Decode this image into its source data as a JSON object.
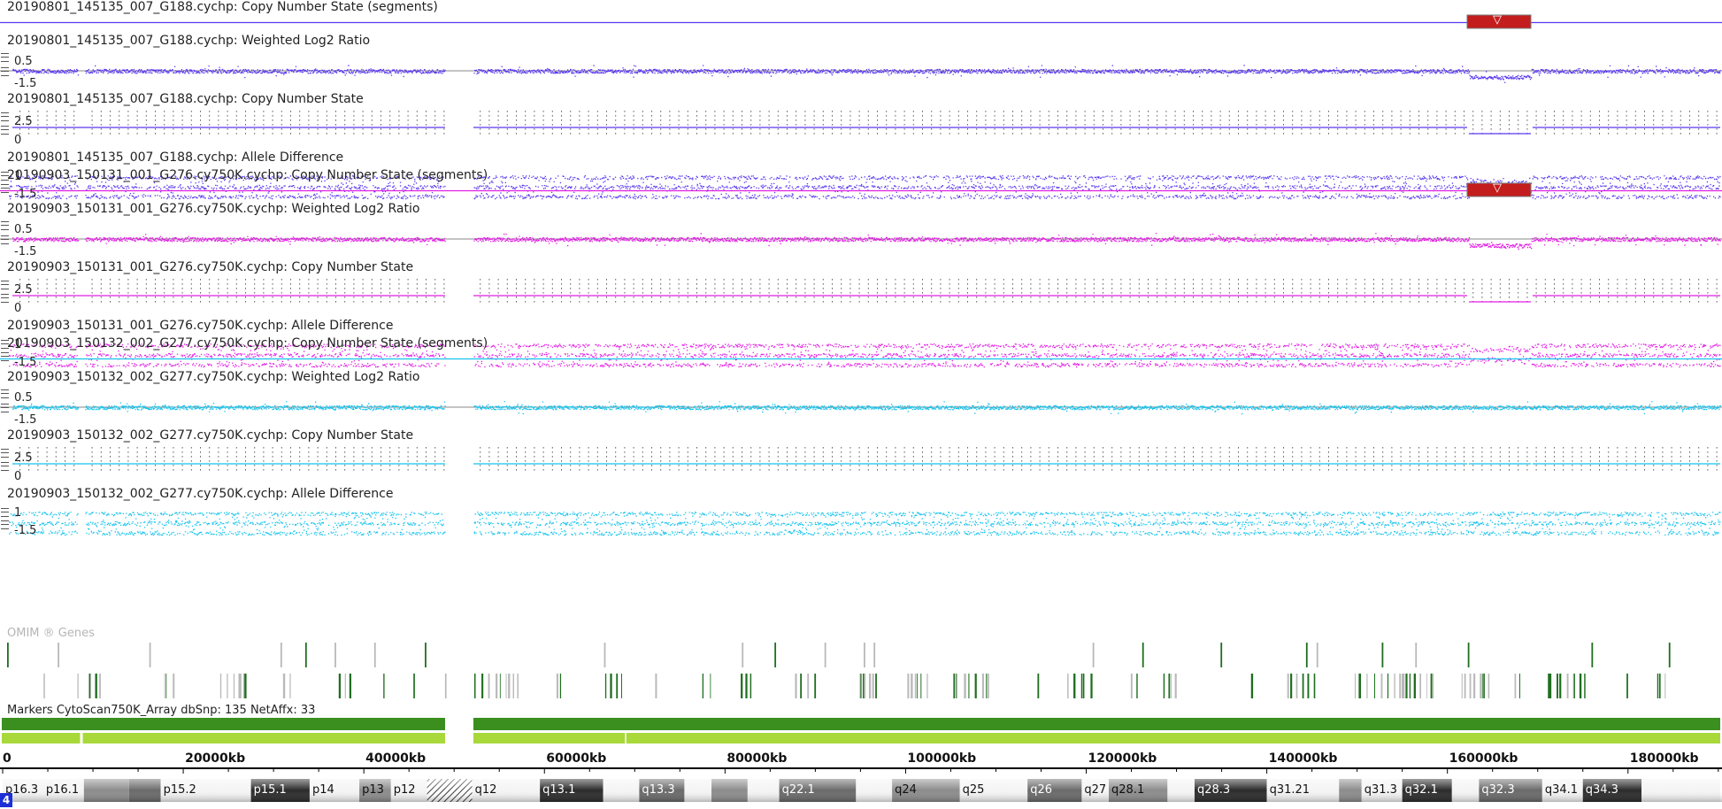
{
  "colors": {
    "sample1": "#5a38f0",
    "sample2": "#e21ee3",
    "sample3": "#15c3ee",
    "loss_marker": "#c41d1d",
    "gene_dark": "#1e6e1e",
    "gene_light": "#b9b9b9",
    "marker_dark": "#3a8f1e",
    "marker_light": "#a8d83a"
  },
  "samples": [
    {
      "segments_label": "20190801_145135_007_G188.cychp: Copy Number State (segments)",
      "log2_label": "20190801_145135_007_G188.cychp: Weighted Log2 Ratio",
      "cn_label": "20190801_145135_007_G188.cychp: Copy Number State",
      "allele_label": "20190801_145135_007_G188.cychp: Allele Difference",
      "has_loss": true,
      "loss_symbol": "▽"
    },
    {
      "segments_label": "20190903_150131_001_G276.cy750K.cychp: Copy Number State (segments)",
      "log2_label": "20190903_150131_001_G276.cy750K.cychp: Weighted Log2 Ratio",
      "cn_label": "20190903_150131_001_G276.cy750K.cychp: Copy Number State",
      "allele_label": "20190903_150131_001_G276.cy750K.cychp: Allele Difference",
      "has_loss": true,
      "loss_symbol": "▽"
    },
    {
      "segments_label": "20190903_150132_002_G277.cy750K.cychp: Copy Number State (segments)",
      "log2_label": "20190903_150132_002_G277.cy750K.cychp: Weighted Log2 Ratio",
      "cn_label": "20190903_150132_002_G277.cy750K.cychp: Copy Number State",
      "allele_label": "20190903_150132_002_G277.cy750K.cychp: Allele Difference",
      "has_loss": false,
      "loss_symbol": ""
    }
  ],
  "axis_labels": {
    "log2_top": "0.5",
    "log2_bottom": "-1.5",
    "cn_top": "2.5",
    "cn_bottom": "0",
    "allele_top": "1",
    "allele_bottom": "-1.5"
  },
  "omim_label": "OMIM ® Genes",
  "markers_label": "Markers CytoScan750K_Array dbSnp: 135 NetAffx: 33",
  "ruler": {
    "ticks": [
      "0",
      "20000kb",
      "40000kb",
      "60000kb",
      "80000kb",
      "100000kb",
      "120000kb",
      "140000kb",
      "160000kb",
      "180000kb"
    ],
    "tick_values_kb": [
      0,
      20000,
      40000,
      60000,
      80000,
      100000,
      120000,
      140000,
      160000,
      180000
    ],
    "max_kb": 190214
  },
  "ideogram": [
    {
      "name": "p16.3",
      "start": 0,
      "end": 4500,
      "stain": "gneg"
    },
    {
      "name": "p16.1",
      "start": 4500,
      "end": 9000,
      "stain": "gneg"
    },
    {
      "name": "",
      "start": 9000,
      "end": 14000,
      "stain": "gpos50"
    },
    {
      "name": "",
      "start": 14000,
      "end": 17500,
      "stain": "gpos75"
    },
    {
      "name": "p15.2",
      "start": 17500,
      "end": 27500,
      "stain": "gneg"
    },
    {
      "name": "p15.1",
      "start": 27500,
      "end": 34000,
      "stain": "gpos100"
    },
    {
      "name": "p14",
      "start": 34000,
      "end": 39500,
      "stain": "gneg"
    },
    {
      "name": "p13",
      "start": 39500,
      "end": 43000,
      "stain": "gpos50"
    },
    {
      "name": "p12",
      "start": 43000,
      "end": 47000,
      "stain": "gneg"
    },
    {
      "name": "",
      "start": 47000,
      "end": 52000,
      "stain": "acen"
    },
    {
      "name": "q12",
      "start": 52000,
      "end": 59500,
      "stain": "gneg"
    },
    {
      "name": "q13.1",
      "start": 59500,
      "end": 66500,
      "stain": "gpos100"
    },
    {
      "name": "",
      "start": 66500,
      "end": 70500,
      "stain": "gneg"
    },
    {
      "name": "q13.3",
      "start": 70500,
      "end": 75500,
      "stain": "gpos75"
    },
    {
      "name": "",
      "start": 75500,
      "end": 78500,
      "stain": "gneg"
    },
    {
      "name": "",
      "start": 78500,
      "end": 82500,
      "stain": "gpos50"
    },
    {
      "name": "",
      "start": 82500,
      "end": 86000,
      "stain": "gneg"
    },
    {
      "name": "q22.1",
      "start": 86000,
      "end": 94500,
      "stain": "gpos75"
    },
    {
      "name": "",
      "start": 94500,
      "end": 98500,
      "stain": "gneg"
    },
    {
      "name": "q24",
      "start": 98500,
      "end": 106000,
      "stain": "gpos50"
    },
    {
      "name": "q25",
      "start": 106000,
      "end": 113500,
      "stain": "gneg"
    },
    {
      "name": "q26",
      "start": 113500,
      "end": 119500,
      "stain": "gpos75"
    },
    {
      "name": "q27",
      "start": 119500,
      "end": 122500,
      "stain": "gneg"
    },
    {
      "name": "q28.1",
      "start": 122500,
      "end": 129000,
      "stain": "gpos50"
    },
    {
      "name": "",
      "start": 129000,
      "end": 132000,
      "stain": "gneg"
    },
    {
      "name": "q28.3",
      "start": 132000,
      "end": 140000,
      "stain": "gpos100"
    },
    {
      "name": "q31.21",
      "start": 140000,
      "end": 148000,
      "stain": "gneg"
    },
    {
      "name": "",
      "start": 148000,
      "end": 150500,
      "stain": "gpos50"
    },
    {
      "name": "q31.3",
      "start": 150500,
      "end": 155000,
      "stain": "gneg"
    },
    {
      "name": "q32.1",
      "start": 155000,
      "end": 160500,
      "stain": "gpos100"
    },
    {
      "name": "",
      "start": 160500,
      "end": 163500,
      "stain": "gneg"
    },
    {
      "name": "q32.3",
      "start": 163500,
      "end": 170500,
      "stain": "gpos75"
    },
    {
      "name": "q34.1",
      "start": 170500,
      "end": 175000,
      "stain": "gneg"
    },
    {
      "name": "q34.3",
      "start": 175000,
      "end": 181500,
      "stain": "gpos100"
    },
    {
      "name": "",
      "start": 181500,
      "end": 190214,
      "stain": "gneg"
    }
  ],
  "chromosome": "4"
}
